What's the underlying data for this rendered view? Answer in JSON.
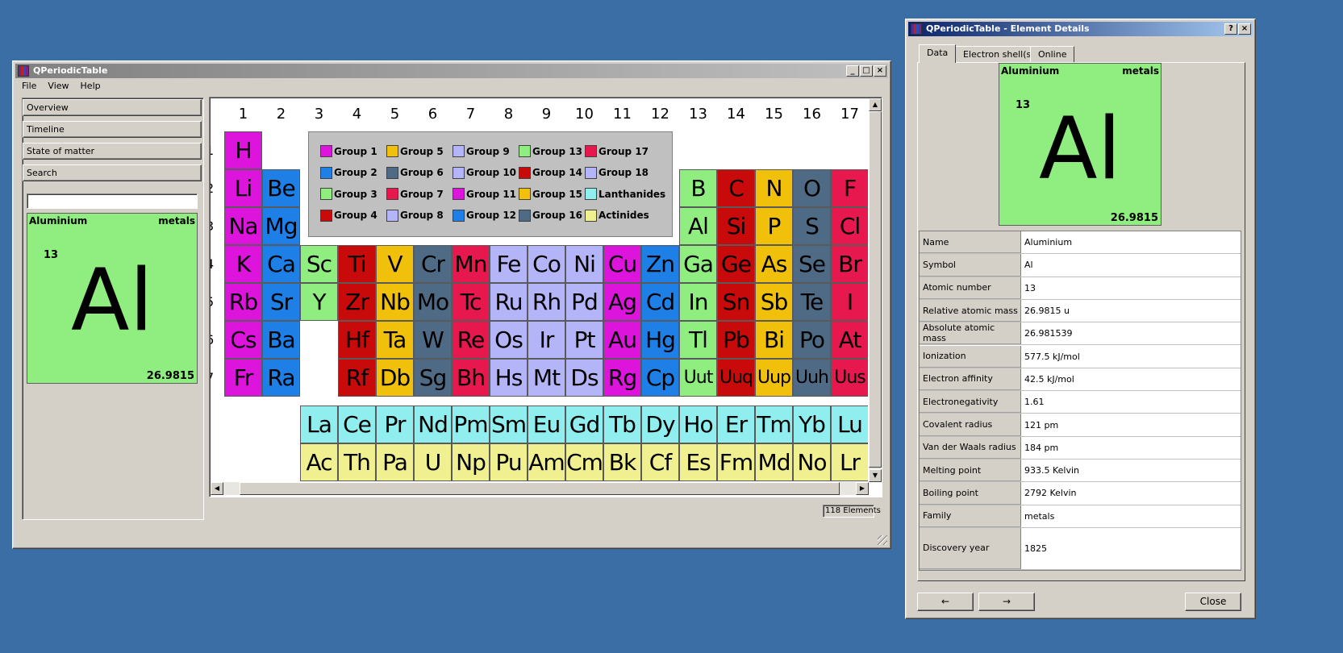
{
  "colors": {
    "g1": "#dc14dc",
    "g2": "#1e7fe6",
    "g3": "#90ee80",
    "g4": "#c80a0a",
    "g5": "#f0c00a",
    "g6": "#4f6a84",
    "g7": "#e6184e",
    "g8": "#b4b4f8",
    "g9": "#b4b4f8",
    "g10": "#b4b4f8",
    "g11": "#dc14dc",
    "g12": "#1e7fe6",
    "g13": "#90ee80",
    "g14": "#c80a0a",
    "g15": "#f0c00a",
    "g16": "#4f6a84",
    "g17": "#e6184e",
    "g18": "#b4b4f8",
    "lan": "#90eeee",
    "act": "#f0f090"
  },
  "main": {
    "title": "QPeriodicTable",
    "menu": [
      "File",
      "View",
      "Help"
    ],
    "toolbox": [
      "Overview",
      "Timeline",
      "State of matter",
      "Search"
    ],
    "search_value": "",
    "status": "118 Elements",
    "card": {
      "name": "Aluminium",
      "family": "metals",
      "number": "13",
      "symbol": "Al",
      "mass": "26.9815"
    },
    "col_headers": [
      "1",
      "2",
      "3",
      "4",
      "5",
      "6",
      "7",
      "8",
      "9",
      "10",
      "11",
      "12",
      "13",
      "14",
      "15",
      "16",
      "17"
    ],
    "row_headers": [
      "1",
      "2",
      "3",
      "4",
      "5",
      "6",
      "7"
    ],
    "legend": [
      {
        "label": "Group 1",
        "c": "g1"
      },
      {
        "label": "Group 2",
        "c": "g2"
      },
      {
        "label": "Group 3",
        "c": "g3"
      },
      {
        "label": "Group 4",
        "c": "g4"
      },
      {
        "label": "Group 5",
        "c": "g5"
      },
      {
        "label": "Group 6",
        "c": "g6"
      },
      {
        "label": "Group 7",
        "c": "g7"
      },
      {
        "label": "Group 8",
        "c": "g8"
      },
      {
        "label": "Group 9",
        "c": "g9"
      },
      {
        "label": "Group 10",
        "c": "g10"
      },
      {
        "label": "Group 11",
        "c": "g11"
      },
      {
        "label": "Group 12",
        "c": "g12"
      },
      {
        "label": "Group 13",
        "c": "g13"
      },
      {
        "label": "Group 14",
        "c": "g14"
      },
      {
        "label": "Group 15",
        "c": "g15"
      },
      {
        "label": "Group 16",
        "c": "g16"
      },
      {
        "label": "Group 17",
        "c": "g17"
      },
      {
        "label": "Group 18",
        "c": "g18"
      },
      {
        "label": "Lanthanides",
        "c": "lan"
      },
      {
        "label": "Actinides",
        "c": "act"
      }
    ],
    "elements": [
      {
        "s": "H",
        "r": 1,
        "c": 1,
        "g": "g1"
      },
      {
        "s": "Li",
        "r": 2,
        "c": 1,
        "g": "g1"
      },
      {
        "s": "Be",
        "r": 2,
        "c": 2,
        "g": "g2"
      },
      {
        "s": "B",
        "r": 2,
        "c": 13,
        "g": "g13"
      },
      {
        "s": "C",
        "r": 2,
        "c": 14,
        "g": "g14"
      },
      {
        "s": "N",
        "r": 2,
        "c": 15,
        "g": "g15"
      },
      {
        "s": "O",
        "r": 2,
        "c": 16,
        "g": "g16"
      },
      {
        "s": "F",
        "r": 2,
        "c": 17,
        "g": "g17"
      },
      {
        "s": "Na",
        "r": 3,
        "c": 1,
        "g": "g1"
      },
      {
        "s": "Mg",
        "r": 3,
        "c": 2,
        "g": "g2"
      },
      {
        "s": "Al",
        "r": 3,
        "c": 13,
        "g": "g13"
      },
      {
        "s": "Si",
        "r": 3,
        "c": 14,
        "g": "g14"
      },
      {
        "s": "P",
        "r": 3,
        "c": 15,
        "g": "g15"
      },
      {
        "s": "S",
        "r": 3,
        "c": 16,
        "g": "g16"
      },
      {
        "s": "Cl",
        "r": 3,
        "c": 17,
        "g": "g17"
      },
      {
        "s": "K",
        "r": 4,
        "c": 1,
        "g": "g1"
      },
      {
        "s": "Ca",
        "r": 4,
        "c": 2,
        "g": "g2"
      },
      {
        "s": "Sc",
        "r": 4,
        "c": 3,
        "g": "g3"
      },
      {
        "s": "Ti",
        "r": 4,
        "c": 4,
        "g": "g4"
      },
      {
        "s": "V",
        "r": 4,
        "c": 5,
        "g": "g5"
      },
      {
        "s": "Cr",
        "r": 4,
        "c": 6,
        "g": "g6"
      },
      {
        "s": "Mn",
        "r": 4,
        "c": 7,
        "g": "g7"
      },
      {
        "s": "Fe",
        "r": 4,
        "c": 8,
        "g": "g8"
      },
      {
        "s": "Co",
        "r": 4,
        "c": 9,
        "g": "g9"
      },
      {
        "s": "Ni",
        "r": 4,
        "c": 10,
        "g": "g10"
      },
      {
        "s": "Cu",
        "r": 4,
        "c": 11,
        "g": "g11"
      },
      {
        "s": "Zn",
        "r": 4,
        "c": 12,
        "g": "g12"
      },
      {
        "s": "Ga",
        "r": 4,
        "c": 13,
        "g": "g13"
      },
      {
        "s": "Ge",
        "r": 4,
        "c": 14,
        "g": "g14"
      },
      {
        "s": "As",
        "r": 4,
        "c": 15,
        "g": "g15"
      },
      {
        "s": "Se",
        "r": 4,
        "c": 16,
        "g": "g16"
      },
      {
        "s": "Br",
        "r": 4,
        "c": 17,
        "g": "g17"
      },
      {
        "s": "Rb",
        "r": 5,
        "c": 1,
        "g": "g1"
      },
      {
        "s": "Sr",
        "r": 5,
        "c": 2,
        "g": "g2"
      },
      {
        "s": "Y",
        "r": 5,
        "c": 3,
        "g": "g3"
      },
      {
        "s": "Zr",
        "r": 5,
        "c": 4,
        "g": "g4"
      },
      {
        "s": "Nb",
        "r": 5,
        "c": 5,
        "g": "g5"
      },
      {
        "s": "Mo",
        "r": 5,
        "c": 6,
        "g": "g6"
      },
      {
        "s": "Tc",
        "r": 5,
        "c": 7,
        "g": "g7"
      },
      {
        "s": "Ru",
        "r": 5,
        "c": 8,
        "g": "g8"
      },
      {
        "s": "Rh",
        "r": 5,
        "c": 9,
        "g": "g9"
      },
      {
        "s": "Pd",
        "r": 5,
        "c": 10,
        "g": "g10"
      },
      {
        "s": "Ag",
        "r": 5,
        "c": 11,
        "g": "g11"
      },
      {
        "s": "Cd",
        "r": 5,
        "c": 12,
        "g": "g12"
      },
      {
        "s": "In",
        "r": 5,
        "c": 13,
        "g": "g13"
      },
      {
        "s": "Sn",
        "r": 5,
        "c": 14,
        "g": "g14"
      },
      {
        "s": "Sb",
        "r": 5,
        "c": 15,
        "g": "g15"
      },
      {
        "s": "Te",
        "r": 5,
        "c": 16,
        "g": "g16"
      },
      {
        "s": "I",
        "r": 5,
        "c": 17,
        "g": "g17"
      },
      {
        "s": "Cs",
        "r": 6,
        "c": 1,
        "g": "g1"
      },
      {
        "s": "Ba",
        "r": 6,
        "c": 2,
        "g": "g2"
      },
      {
        "s": "Hf",
        "r": 6,
        "c": 4,
        "g": "g4"
      },
      {
        "s": "Ta",
        "r": 6,
        "c": 5,
        "g": "g5"
      },
      {
        "s": "W",
        "r": 6,
        "c": 6,
        "g": "g6"
      },
      {
        "s": "Re",
        "r": 6,
        "c": 7,
        "g": "g7"
      },
      {
        "s": "Os",
        "r": 6,
        "c": 8,
        "g": "g8"
      },
      {
        "s": "Ir",
        "r": 6,
        "c": 9,
        "g": "g9"
      },
      {
        "s": "Pt",
        "r": 6,
        "c": 10,
        "g": "g10"
      },
      {
        "s": "Au",
        "r": 6,
        "c": 11,
        "g": "g11"
      },
      {
        "s": "Hg",
        "r": 6,
        "c": 12,
        "g": "g12"
      },
      {
        "s": "Tl",
        "r": 6,
        "c": 13,
        "g": "g13"
      },
      {
        "s": "Pb",
        "r": 6,
        "c": 14,
        "g": "g14"
      },
      {
        "s": "Bi",
        "r": 6,
        "c": 15,
        "g": "g15"
      },
      {
        "s": "Po",
        "r": 6,
        "c": 16,
        "g": "g16"
      },
      {
        "s": "At",
        "r": 6,
        "c": 17,
        "g": "g17"
      },
      {
        "s": "Fr",
        "r": 7,
        "c": 1,
        "g": "g1"
      },
      {
        "s": "Ra",
        "r": 7,
        "c": 2,
        "g": "g2"
      },
      {
        "s": "Rf",
        "r": 7,
        "c": 4,
        "g": "g4"
      },
      {
        "s": "Db",
        "r": 7,
        "c": 5,
        "g": "g5"
      },
      {
        "s": "Sg",
        "r": 7,
        "c": 6,
        "g": "g6"
      },
      {
        "s": "Bh",
        "r": 7,
        "c": 7,
        "g": "g7"
      },
      {
        "s": "Hs",
        "r": 7,
        "c": 8,
        "g": "g8"
      },
      {
        "s": "Mt",
        "r": 7,
        "c": 9,
        "g": "g9"
      },
      {
        "s": "Ds",
        "r": 7,
        "c": 10,
        "g": "g10"
      },
      {
        "s": "Rg",
        "r": 7,
        "c": 11,
        "g": "g11"
      },
      {
        "s": "Cp",
        "r": 7,
        "c": 12,
        "g": "g12"
      },
      {
        "s": "Uut",
        "r": 7,
        "c": 13,
        "g": "g13"
      },
      {
        "s": "Uuq",
        "r": 7,
        "c": 14,
        "g": "g14"
      },
      {
        "s": "Uup",
        "r": 7,
        "c": 15,
        "g": "g15"
      },
      {
        "s": "Uuh",
        "r": 7,
        "c": 16,
        "g": "g16"
      },
      {
        "s": "Uus",
        "r": 7,
        "c": 17,
        "g": "g17"
      }
    ],
    "lanthanides": [
      "La",
      "Ce",
      "Pr",
      "Nd",
      "Pm",
      "Sm",
      "Eu",
      "Gd",
      "Tb",
      "Dy",
      "Ho",
      "Er",
      "Tm",
      "Yb",
      "Lu"
    ],
    "actinides": [
      "Ac",
      "Th",
      "Pa",
      "U",
      "Np",
      "Pu",
      "Am",
      "Cm",
      "Bk",
      "Cf",
      "Es",
      "Fm",
      "Md",
      "No",
      "Lr"
    ]
  },
  "details": {
    "title": "QPeriodicTable - Element Details",
    "tabs": [
      "Data",
      "Electron shell(s)",
      "Online"
    ],
    "card": {
      "name": "Aluminium",
      "family": "metals",
      "number": "13",
      "symbol": "Al",
      "mass": "26.9815"
    },
    "rows": [
      {
        "label": "Name",
        "value": "Aluminium"
      },
      {
        "label": "Symbol",
        "value": "Al"
      },
      {
        "label": "Atomic number",
        "value": "13"
      },
      {
        "label": "Relative atomic mass",
        "value": "26.9815 u"
      },
      {
        "label": "Absolute atomic mass",
        "value": "26.981539"
      },
      {
        "label": "Ionization",
        "value": "577.5 kJ/mol"
      },
      {
        "label": "Electron affinity",
        "value": "42.5 kJ/mol"
      },
      {
        "label": "Electronegativity",
        "value": "1.61"
      },
      {
        "label": "Covalent radius",
        "value": "121 pm"
      },
      {
        "label": "Van der Waals radius",
        "value": "184 pm"
      },
      {
        "label": "Melting point",
        "value": "933.5 Kelvin"
      },
      {
        "label": "Boiling point",
        "value": "2792 Kelvin"
      },
      {
        "label": "Family",
        "value": "metals"
      },
      {
        "label": "Discovery year",
        "value": "1825"
      }
    ],
    "prev_label": "←",
    "next_label": "→",
    "close_label": "Close"
  }
}
